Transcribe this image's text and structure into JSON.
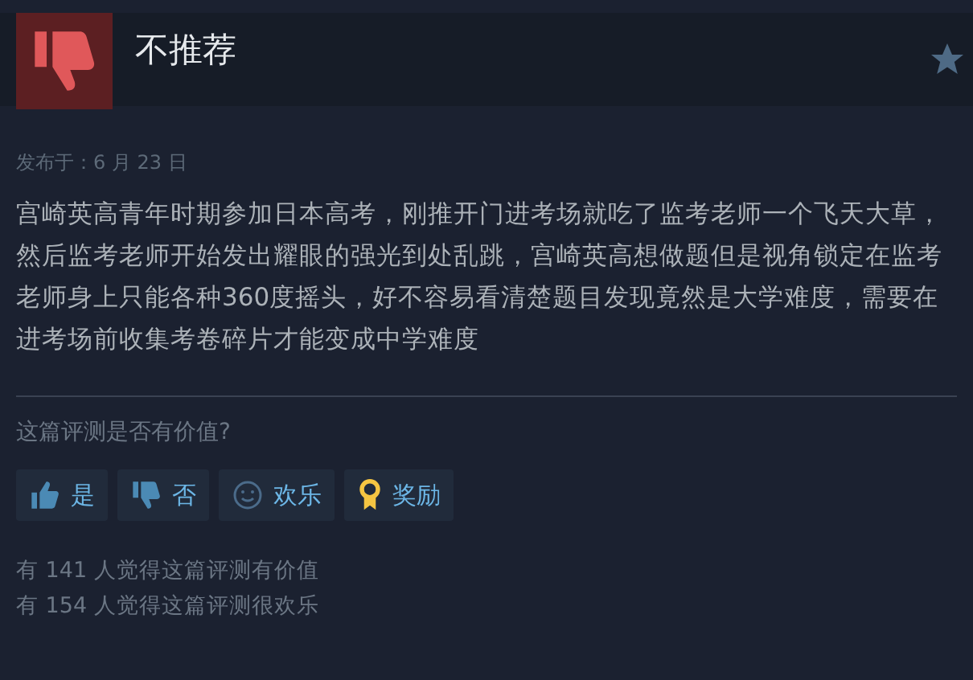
{
  "header": {
    "verdict": "不推荐",
    "recommended": false
  },
  "posted": "发布于：6 月 23 日",
  "review": "宫崎英高青年时期参加日本高考，刚推开门进考场就吃了监考老师一个飞天大草，然后监考老师开始发出耀眼的强光到处乱跳，宫崎英高想做题但是视角锁定在监考老师身上只能各种360度摇头，好不容易看清楚题目发现竟然是大学难度，需要在进考场前收集考卷碎片才能变成中学难度",
  "helpful_prompt": "这篇评测是否有价值?",
  "buttons": [
    {
      "kind": "up",
      "label": "是"
    },
    {
      "kind": "down",
      "label": "否"
    },
    {
      "kind": "funny",
      "label": "欢乐"
    },
    {
      "kind": "award",
      "label": "奖励"
    }
  ],
  "stats": [
    "有 141 人觉得这篇评测有价值",
    "有 154 人觉得这篇评测很欢乐"
  ]
}
